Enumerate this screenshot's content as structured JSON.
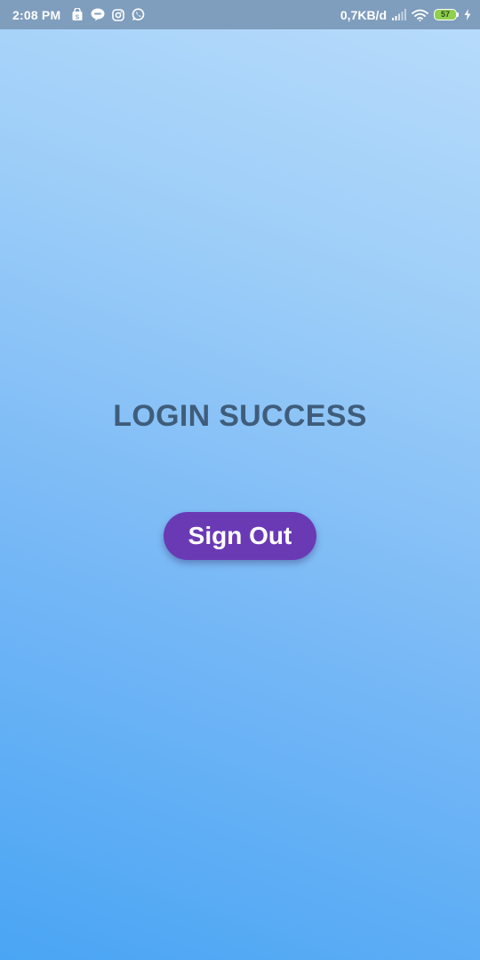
{
  "status_bar": {
    "time": "2:08 PM",
    "network_speed": "0,7KB/d",
    "battery_level": "57",
    "notification_icons": [
      "shopping-bag-icon",
      "line-chat-icon",
      "instagram-icon",
      "whatsapp-icon"
    ],
    "system_icons": [
      "signal-icon",
      "wifi-icon",
      "battery-icon",
      "charging-icon"
    ],
    "battery_color": "#8fd14f"
  },
  "main": {
    "title": "LOGIN SUCCESS",
    "signout_label": "Sign Out",
    "title_color": "#3f5d7a",
    "button_color": "#6a3ab5"
  }
}
